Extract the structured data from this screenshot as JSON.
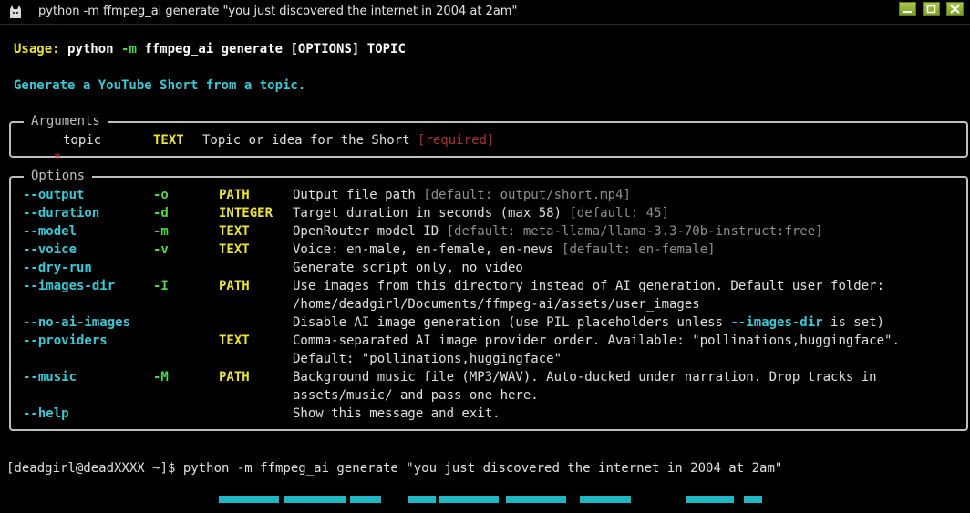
{
  "window": {
    "title": "python -m ffmpeg_ai generate \"you just discovered the internet in 2004 at 2am\"",
    "icon": "cat-icon"
  },
  "usage": {
    "label": "Usage:",
    "cmd_a": "python",
    "flag": "-m",
    "cmd_b": "ffmpeg_ai generate [OPTIONS] TOPIC"
  },
  "description": "Generate a YouTube Short from a topic.",
  "arguments": {
    "title": "Arguments",
    "items": [
      {
        "marker": "*",
        "name": "topic",
        "type": "TEXT",
        "help": "Topic or idea for the Short",
        "required": "[required]"
      }
    ]
  },
  "options": {
    "title": "Options",
    "rows": [
      {
        "long": "--output",
        "short": "-o",
        "type": "PATH",
        "help": "Output file path ",
        "default": "[default: output/short.mp4]"
      },
      {
        "long": "--duration",
        "short": "-d",
        "type": "INTEGER",
        "help": "Target duration in seconds (max 58) ",
        "default": "[default: 45]"
      },
      {
        "long": "--model",
        "short": "-m",
        "type": "TEXT",
        "help": "OpenRouter model ID ",
        "default": "[default: meta-llama/llama-3.3-70b-instruct:free]"
      },
      {
        "long": "--voice",
        "short": "-v",
        "type": "TEXT",
        "help": "Voice: en-male, en-female, en-news ",
        "default": "[default: en-female]"
      },
      {
        "long": "--dry-run",
        "short": "",
        "type": "",
        "help": "Generate script only, no video",
        "default": ""
      },
      {
        "long": "--images-dir",
        "short": "-I",
        "type": "PATH",
        "help": "Use images from this directory instead of AI generation. Default user folder:",
        "help2": "/home/deadgirl/Documents/ffmpeg-ai/assets/user_images",
        "default": ""
      },
      {
        "long": "--no-ai-images",
        "short": "",
        "type": "",
        "help": "Disable AI image generation (use PIL placeholders unless ",
        "help_flag": "--images-dir",
        "help_tail": " is set)",
        "default": ""
      },
      {
        "long": "--providers",
        "short": "",
        "type": "TEXT",
        "help": "Comma-separated AI image provider order. Available: \"pollinations,huggingface\".",
        "help2": "Default: \"pollinations,huggingface\"",
        "default": ""
      },
      {
        "long": "--music",
        "short": "-M",
        "type": "PATH",
        "help": "Background music file (MP3/WAV). Auto-ducked under narration. Drop tracks in",
        "help2": "assets/music/ and pass one here.",
        "default": ""
      },
      {
        "long": "--help",
        "short": "",
        "type": "",
        "help": "Show this message and exit.",
        "default": ""
      }
    ]
  },
  "prompt": {
    "text": "[deadgirl@deadXXXX ~]$ python -m ffmpeg_ai generate \"you just discovered the internet in 2004 at 2am\""
  },
  "colors": {
    "background": "#000000",
    "yellow": "#e9e33a",
    "green": "#52d64b",
    "cyan": "#3cc8d6",
    "required": "#a8332e",
    "titlebar_buttons": "#8fb03a"
  }
}
